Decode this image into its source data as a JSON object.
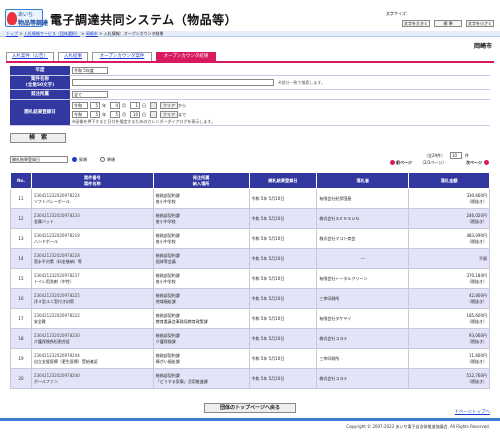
{
  "header": {
    "logo_line1": "あいち",
    "logo_line2": "物品等調達",
    "title": "電子調達共同システム（物品等）",
    "font_size_label": "文字サイズ：",
    "buttons": [
      "文字を大きく",
      "標 準",
      "文字を小さく"
    ]
  },
  "breadcrumb": {
    "items": [
      "トップ",
      "入札情報サービス（団体選択）",
      "岡崎市",
      "入札情報：オープンカウンタ結果"
    ],
    "separator": " > "
  },
  "city": "岡崎市",
  "tabs": [
    "入札案件（公告）",
    "入札結果",
    "オープンカウンタ案件",
    "オープンカウンタ結果"
  ],
  "form": {
    "year_label": "年度",
    "year_value": "令和 5年度",
    "name_label": "案件名称",
    "name_sub": "(全角50文字)",
    "name_hint": "※部分一致で検索します。",
    "dept_label": "発注所属",
    "dept_value": "全て",
    "date_label": "開札結果登録日",
    "from": {
      "era": "令和",
      "year": "5",
      "month": "4",
      "day": "1"
    },
    "to": {
      "era": "令和",
      "year": "5",
      "month": "5",
      "day": "10"
    },
    "unit_year": "年",
    "unit_month": "月",
    "unit_day": "日",
    "clear": "クリア",
    "kara": "から",
    "made": "まで",
    "cal_note": "※画像を押下すると日付を指定するためのカレンダーダイアログを表示します。",
    "search": "検　索"
  },
  "sort": {
    "order_value": "開札結果登録日",
    "asc": "昇順",
    "desc": "降順",
    "count_text": "全29件",
    "per_page": "10",
    "per_page_suffix": "件",
    "prev": "前ページ",
    "page_info": "（2/3ページ）",
    "next": "次ページ"
  },
  "table": {
    "headers": {
      "no": "No.",
      "num_name": [
        "案件番号",
        "案件名称"
      ],
      "dept": [
        "発注所属",
        "納入場所"
      ],
      "date": "開札結果登録日",
      "winner": "落札者",
      "amount": "落札金額"
    },
    "rows": [
      {
        "no": "11",
        "id": "230421232020978224",
        "name": "ソフトバレーボール",
        "dept": "総務部契約課",
        "place": "各小中学校",
        "date": "令和 5年 5月10日",
        "winner": "有限会社紀伊国屋",
        "amount": "330,660円",
        "tax": "（税抜き）"
      },
      {
        "no": "12",
        "id": "230421232020978233",
        "name": "金属バット",
        "dept": "総務部契約課",
        "place": "各小中学校",
        "date": "令和 5年 5月10日",
        "winner": "株式会社ＳＥＲＳＵＮ",
        "amount": "246,020円",
        "tax": "（税抜き）"
      },
      {
        "no": "13",
        "id": "230421232020978219",
        "name": "ハンドボール",
        "dept": "総務部契約課",
        "place": "各小中学校",
        "date": "令和 5年 5月10日",
        "winner": "株式会社マコト商会",
        "amount": "483,090円",
        "tax": "（税抜き）"
      },
      {
        "no": "14",
        "id": "230421232020978228",
        "name": "窓水平対策（料金後納）等",
        "dept": "総務部契約課",
        "place": "固体等会議",
        "date": "令和 5年 5月10日",
        "winner": "---",
        "amount": "不調",
        "tax": ""
      },
      {
        "no": "15",
        "id": "230421232020978237",
        "name": "トイレ用洗剤（中性）",
        "dept": "総務部契約課",
        "place": "各小中学校",
        "date": "令和 5年 5月10日",
        "winner": "有限会社トータルクリーン",
        "amount": "370,184円",
        "tax": "（税抜き）"
      },
      {
        "no": "16",
        "id": "230421232020978225",
        "name": "洋４型ユニ窓付き封筒",
        "dept": "総務部契約課",
        "place": "地域福祉課",
        "date": "令和 5年 5月10日",
        "winner": "三幸印刷所",
        "amount": "42,800円",
        "tax": "（税抜き）"
      },
      {
        "no": "17",
        "id": "230421232020978222",
        "name": "安全靴",
        "dept": "総務部契約課",
        "place": "教育委員会事務局教育政策課",
        "date": "令和 5年 5月10日",
        "winner": "有限会社タケヤイ",
        "amount": "185,600円",
        "tax": "（税抜き）"
      },
      {
        "no": "18",
        "id": "230421232020978230",
        "name": "介護保険負担割合証",
        "dept": "総務部契約課",
        "place": "介護保険課",
        "date": "令和 5年 5月10日",
        "winner": "株式会社コヨテ",
        "amount": "93,060円",
        "tax": "（税抜き）"
      },
      {
        "no": "19",
        "id": "230421232020978244",
        "name": "自立支援医療（更生医療）受給者証",
        "dept": "総務部契約課",
        "place": "障がい福祉課",
        "date": "令和 5年 5月10日",
        "winner": "三幸印刷所",
        "amount": "11,660円",
        "tax": "（税抜き）"
      },
      {
        "no": "20",
        "id": "230421232020978240",
        "name": "ボールファン",
        "dept": "総務部契約課",
        "place": "「どうする家康」活用推進課",
        "date": "令和 5年 5月10日",
        "winner": "株式会社コヨテ",
        "amount": "512,760円",
        "tax": "（税抜き）"
      }
    ]
  },
  "back_button": "団体のトップページへ戻る",
  "page_top": "↑ページトップへ",
  "footer": "Copyright © 2007-2023 あいち電子自治体推進協議会. All Rights Reserved.",
  "colors": {
    "accent": "#d81b60",
    "header_blue": "#3238a0",
    "row_alt": "#e4e4f8"
  }
}
